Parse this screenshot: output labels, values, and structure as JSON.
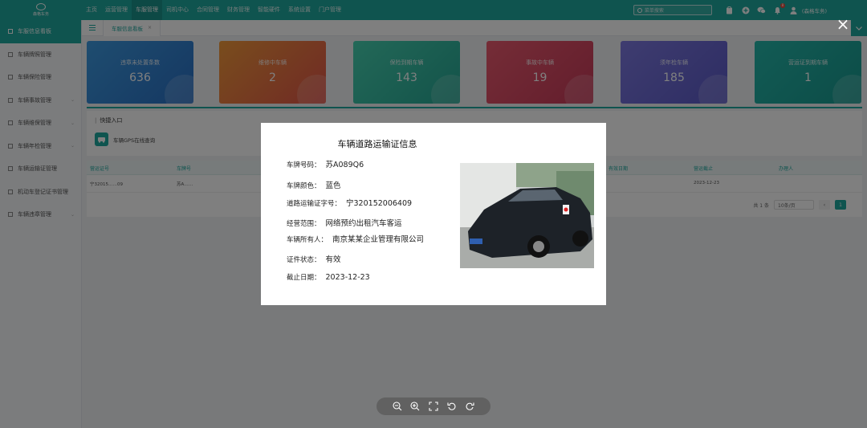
{
  "app": {
    "logo_text": "森格车务"
  },
  "topnav": {
    "items": [
      "主页",
      "运营管理",
      "车服管理",
      "司机中心",
      "合同管理",
      "财务管理",
      "智能硬件",
      "系统设置",
      "门户管理"
    ],
    "active_index": 2
  },
  "top_right": {
    "search_placeholder": "菜单搜索",
    "notification_count": "8",
    "user_name": "(森格车务)"
  },
  "sidebar": {
    "items": [
      {
        "label": "车服信息看板",
        "active": true,
        "has_children": false
      },
      {
        "label": "车辆牌照管理",
        "active": false,
        "has_children": false
      },
      {
        "label": "车辆保险管理",
        "active": false,
        "has_children": false
      },
      {
        "label": "车辆事故管理",
        "active": false,
        "has_children": true
      },
      {
        "label": "车辆维保管理",
        "active": false,
        "has_children": true
      },
      {
        "label": "车辆年检管理",
        "active": false,
        "has_children": true
      },
      {
        "label": "车辆运输证管理",
        "active": false,
        "has_children": false
      },
      {
        "label": "机动车登记证书管理",
        "active": false,
        "has_children": false
      },
      {
        "label": "车辆违章管理",
        "active": false,
        "has_children": true
      }
    ]
  },
  "tabs": [
    {
      "label": "车服信息看板",
      "close": "×"
    }
  ],
  "stats": [
    {
      "label": "违章未处置条数",
      "value": "636"
    },
    {
      "label": "维修中车辆",
      "value": "2"
    },
    {
      "label": "保险到期车辆",
      "value": "143"
    },
    {
      "label": "事故中车辆",
      "value": "19"
    },
    {
      "label": "须年检车辆",
      "value": "185"
    },
    {
      "label": "营运证到期车辆",
      "value": "1"
    }
  ],
  "quick_entry": {
    "title": "快捷入口",
    "items": [
      {
        "label": "车辆GPS在线查询"
      }
    ]
  },
  "table": {
    "headers": [
      "营运证号",
      "车牌号",
      "",
      "",
      "",
      "",
      "",
      "有效日期",
      "营运截止",
      "办理人"
    ],
    "rows": [
      [
        "宁32015……09",
        "苏A……",
        "",
        "",
        "",
        "",
        "",
        "",
        "2023-12-23",
        ""
      ]
    ]
  },
  "pager": {
    "total": "共 1 条",
    "page_size": "10条/页",
    "current": "1",
    "prev": "‹",
    "next": "›"
  },
  "dialog": {
    "title": "车辆道路运输证信息",
    "fields": [
      {
        "key": "车牌号码：",
        "value": "苏A089Q6"
      },
      {
        "key": "车牌颜色：",
        "value": "蓝色"
      },
      {
        "key": "道路运输证字号：",
        "value": "宁320152006409"
      },
      {
        "key": "经营范围：",
        "value": "网络预约出租汽车客运"
      },
      {
        "key": "车辆所有人：",
        "value": "南京某某企业管理有限公司"
      },
      {
        "key": "证件状态：",
        "value": "有效"
      },
      {
        "key": "截止日期：",
        "value": "2023-12-23"
      }
    ]
  },
  "viewer": {
    "close": "×"
  },
  "colors": {
    "brand": "#1fa89e",
    "overlay": "#000000"
  }
}
